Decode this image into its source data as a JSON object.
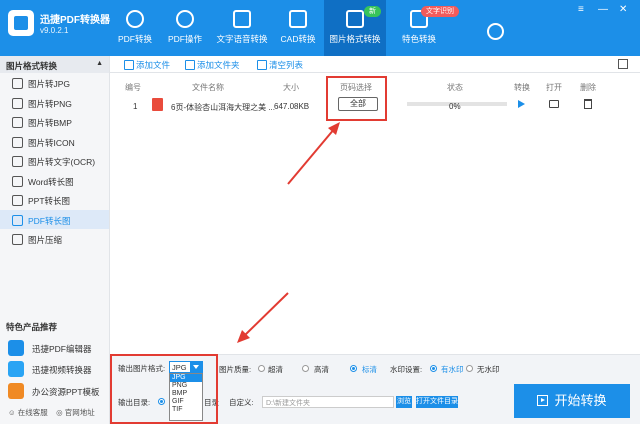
{
  "app": {
    "name": "迅捷PDF转换器",
    "version": "v9.0.2.1"
  },
  "nav": [
    {
      "label": "PDF转换",
      "icon": "pdf-convert-icon"
    },
    {
      "label": "PDF操作",
      "icon": "pdf-operate-icon"
    },
    {
      "label": "文字语音转换",
      "icon": "voice-icon"
    },
    {
      "label": "CAD转换",
      "icon": "cad-icon"
    },
    {
      "label": "图片格式转换",
      "icon": "image-icon"
    },
    {
      "label": "特色转换",
      "icon": "special-convert-icon"
    }
  ],
  "badges": {
    "new": "新",
    "ocr": "文字识别"
  },
  "sidebar": {
    "header": "图片格式转换",
    "items": [
      "图片转JPG",
      "图片转PNG",
      "图片转BMP",
      "图片转ICON",
      "图片转文字(OCR)",
      "Word转长图",
      "PPT转长图",
      "PDF转长图",
      "图片压缩"
    ],
    "featured_title": "特色产品推荐",
    "products": [
      "迅捷PDF编辑器",
      "迅捷视频转换器",
      "办公资源PPT模板"
    ],
    "footer": [
      "在线客服",
      "官网地址"
    ]
  },
  "toolbar": {
    "add_file": "添加文件",
    "add_folder": "添加文件夹",
    "clear_list": "清空列表"
  },
  "table": {
    "headers": [
      "编号",
      "文件名称",
      "大小",
      "页码选择",
      "状态",
      "转换",
      "打开",
      "删除"
    ],
    "rows": [
      {
        "index": "1",
        "name": "6页-体验杏山洱海大理之美 ...",
        "size": "647.08KB",
        "pages": "全部",
        "status": "0%",
        "progress": 0
      }
    ]
  },
  "settings": {
    "format_label": "输出图片格式:",
    "format_value": "JPG",
    "format_options": [
      "JPG",
      "PNG",
      "BMP",
      "GIF",
      "TIF"
    ],
    "quality_label": "图片质量:",
    "quality_options": [
      "超清",
      "高清",
      "标清"
    ],
    "quality_selected": "标清",
    "watermark_label": "水印设置:",
    "watermark_options": [
      "有水印",
      "无水印"
    ],
    "watermark_selected": "有水印",
    "output_label": "输出目录:",
    "output_suffix": "目录",
    "custom_label": "自定义:",
    "path_value": "D:\\新建文件夹",
    "browse": "浏览",
    "open_dir": "打开文件目录",
    "start": "开始转换"
  },
  "colors": {
    "primary": "#1c8fe8",
    "highlight": "#e23b32"
  }
}
